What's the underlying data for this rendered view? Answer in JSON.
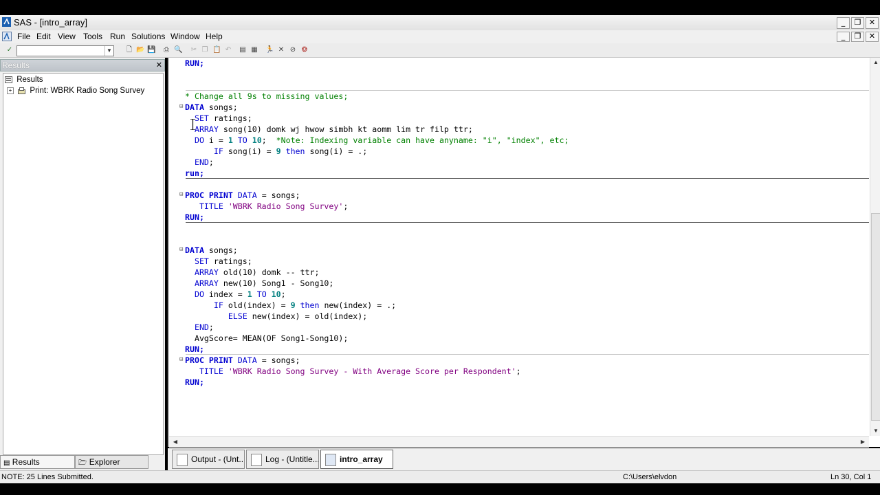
{
  "window": {
    "title": "SAS - [intro_array]"
  },
  "window_buttons": [
    "_",
    "❐",
    "✕"
  ],
  "inner_buttons": [
    "_",
    "❐",
    "✕"
  ],
  "menu": [
    "File",
    "Edit",
    "View",
    "Tools",
    "Run",
    "Solutions",
    "Window",
    "Help"
  ],
  "command_box": {
    "value": ""
  },
  "results_pane": {
    "header": "Results",
    "tree": [
      {
        "label": "Results",
        "expander": ""
      },
      {
        "label": "Print:  WBRK Radio Song Survey",
        "expander": "+"
      }
    ],
    "tabs": [
      "Results",
      "Explorer"
    ]
  },
  "code_lines": [
    {
      "parts": [
        {
          "t": "RUN;",
          "c": "kw bold"
        }
      ]
    },
    {
      "parts": []
    },
    {
      "parts": []
    },
    {
      "parts": [
        {
          "t": "* Change all 9s to missing values;",
          "c": "cm"
        }
      ]
    },
    {
      "parts": [
        {
          "t": "DATA",
          "c": "kw bold"
        },
        {
          "t": " songs;",
          "c": ""
        }
      ]
    },
    {
      "parts": [
        {
          "t": "  SET",
          "c": "kw"
        },
        {
          "t": " ratings;",
          "c": ""
        }
      ]
    },
    {
      "parts": [
        {
          "t": "  ARRAY",
          "c": "kw"
        },
        {
          "t": " song(10) domk wj hwow simbh kt aomm lim tr filp ttr;",
          "c": ""
        }
      ]
    },
    {
      "parts": [
        {
          "t": "  DO",
          "c": "kw"
        },
        {
          "t": " i = ",
          "c": ""
        },
        {
          "t": "1",
          "c": "nm bold"
        },
        {
          "t": " TO ",
          "c": "kw"
        },
        {
          "t": "10",
          "c": "nm bold"
        },
        {
          "t": ";  ",
          "c": ""
        },
        {
          "t": "*Note: Indexing variable can have anyname: \"i\", \"index\", etc;",
          "c": "cm"
        }
      ]
    },
    {
      "parts": [
        {
          "t": "      IF",
          "c": "kw"
        },
        {
          "t": " song(i) = ",
          "c": ""
        },
        {
          "t": "9",
          "c": "nm bold"
        },
        {
          "t": " then",
          "c": "kw"
        },
        {
          "t": " song(i) = .;",
          "c": ""
        }
      ]
    },
    {
      "parts": [
        {
          "t": "  END",
          "c": "kw"
        },
        {
          "t": ";",
          "c": ""
        }
      ]
    },
    {
      "parts": [
        {
          "t": "run;",
          "c": "kw bold"
        }
      ]
    },
    {
      "parts": []
    },
    {
      "parts": [
        {
          "t": "PROC PRINT",
          "c": "kw bold"
        },
        {
          "t": " DATA",
          "c": "kw"
        },
        {
          "t": " = songs;",
          "c": ""
        }
      ]
    },
    {
      "parts": [
        {
          "t": "   TITLE",
          "c": "kw"
        },
        {
          "t": " 'WBRK Radio Song Survey'",
          "c": "st"
        },
        {
          "t": ";",
          "c": ""
        }
      ]
    },
    {
      "parts": [
        {
          "t": "RUN;",
          "c": "kw bold"
        }
      ]
    },
    {
      "parts": []
    },
    {
      "parts": []
    },
    {
      "parts": [
        {
          "t": "DATA",
          "c": "kw bold"
        },
        {
          "t": " songs;",
          "c": ""
        }
      ]
    },
    {
      "parts": [
        {
          "t": "  SET",
          "c": "kw"
        },
        {
          "t": " ratings;",
          "c": ""
        }
      ]
    },
    {
      "parts": [
        {
          "t": "  ARRAY",
          "c": "kw"
        },
        {
          "t": " old(10) domk -- ttr;",
          "c": ""
        }
      ]
    },
    {
      "parts": [
        {
          "t": "  ARRAY",
          "c": "kw"
        },
        {
          "t": " new(10) Song1 - Song10;",
          "c": ""
        }
      ]
    },
    {
      "parts": [
        {
          "t": "  DO",
          "c": "kw"
        },
        {
          "t": " index = ",
          "c": ""
        },
        {
          "t": "1",
          "c": "nm bold"
        },
        {
          "t": " TO ",
          "c": "kw"
        },
        {
          "t": "10",
          "c": "nm bold"
        },
        {
          "t": ";",
          "c": ""
        }
      ]
    },
    {
      "parts": [
        {
          "t": "      IF",
          "c": "kw"
        },
        {
          "t": " old(index) = ",
          "c": ""
        },
        {
          "t": "9",
          "c": "nm bold"
        },
        {
          "t": " then",
          "c": "kw"
        },
        {
          "t": " new(index) = .;",
          "c": ""
        }
      ]
    },
    {
      "parts": [
        {
          "t": "         ELSE",
          "c": "kw"
        },
        {
          "t": " new(index) = old(index);",
          "c": ""
        }
      ]
    },
    {
      "parts": [
        {
          "t": "  END",
          "c": "kw"
        },
        {
          "t": ";",
          "c": ""
        }
      ]
    },
    {
      "parts": [
        {
          "t": "  AvgScore= MEAN(OF Song1-Song10);",
          "c": ""
        }
      ]
    },
    {
      "parts": [
        {
          "t": "RUN;",
          "c": "kw bold"
        }
      ]
    },
    {
      "parts": [
        {
          "t": "PROC PRINT",
          "c": "kw bold"
        },
        {
          "t": " DATA",
          "c": "kw"
        },
        {
          "t": " = songs;",
          "c": ""
        }
      ]
    },
    {
      "parts": [
        {
          "t": "   TITLE",
          "c": "kw"
        },
        {
          "t": " 'WBRK Radio Song Survey - With Average Score per Respondent'",
          "c": "st"
        },
        {
          "t": ";",
          "c": ""
        }
      ]
    },
    {
      "parts": [
        {
          "t": "RUN;",
          "c": "kw bold"
        }
      ]
    }
  ],
  "fold_marker": "⊟",
  "window_tabs": [
    {
      "label": "Output - (Unt...",
      "active": false
    },
    {
      "label": "Log - (Untitle...",
      "active": false
    },
    {
      "label": "intro_array",
      "active": true
    }
  ],
  "status": {
    "message": "NOTE:  25 Lines Submitted.",
    "path": "C:\\Users\\elvdon",
    "position": "Ln 30, Col 1"
  },
  "colors": {
    "keyword": "#0000d0",
    "comment": "#008000",
    "string": "#800080",
    "number": "#007f7f"
  }
}
